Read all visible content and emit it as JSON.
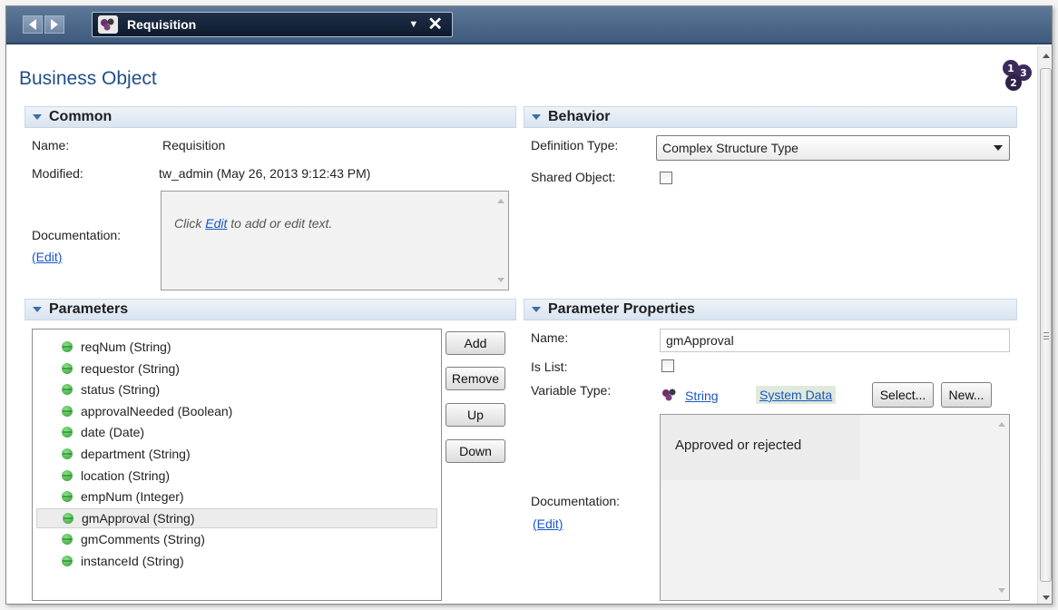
{
  "tab": {
    "title": "Requisition"
  },
  "page": {
    "title": "Business Object"
  },
  "common": {
    "header": "Common",
    "name_label": "Name:",
    "name_value": "Requisition",
    "modified_label": "Modified:",
    "modified_value": "tw_admin (May 26, 2013 9:12:43 PM)",
    "documentation_label": "Documentation:",
    "edit_link": "(Edit)",
    "doc_placeholder_prefix": "Click ",
    "doc_placeholder_link": "Edit",
    "doc_placeholder_suffix": " to add or edit text."
  },
  "behavior": {
    "header": "Behavior",
    "definition_type_label": "Definition Type:",
    "definition_type_value": "Complex Structure Type",
    "shared_object_label": "Shared Object:",
    "shared_object_checked": false
  },
  "parameters": {
    "header": "Parameters",
    "items": [
      {
        "label": "reqNum (String)"
      },
      {
        "label": "requestor (String)"
      },
      {
        "label": "status (String)"
      },
      {
        "label": "approvalNeeded (Boolean)"
      },
      {
        "label": "date (Date)"
      },
      {
        "label": "department (String)"
      },
      {
        "label": "location (String)"
      },
      {
        "label": "empNum (Integer)"
      },
      {
        "label": "gmApproval (String)"
      },
      {
        "label": "gmComments (String)"
      },
      {
        "label": "instanceId (String)"
      }
    ],
    "selected_index": 8,
    "buttons": {
      "add": "Add",
      "remove": "Remove",
      "up": "Up",
      "down": "Down"
    }
  },
  "parameter_properties": {
    "header": "Parameter Properties",
    "name_label": "Name:",
    "name_value": "gmApproval",
    "is_list_label": "Is List:",
    "is_list_checked": false,
    "variable_type_label": "Variable Type:",
    "variable_type_value": "String",
    "variable_type_source": "System Data",
    "select_button": "Select...",
    "new_button": "New...",
    "documentation_label": "Documentation:",
    "edit_link": "(Edit)",
    "documentation_text": "Approved or rejected"
  },
  "colors": {
    "title_blue": "#1f4f86",
    "tabbar": "#3e5a7c",
    "link": "#1a55c7",
    "status_green": "#2e9a2e",
    "system_data_bg": "#dfeadc"
  },
  "icons": [
    "back-arrow-icon",
    "forward-arrow-icon",
    "business-object-icon",
    "dropdown-caret-icon",
    "close-icon",
    "numbered-steps-icon",
    "collapse-caret-icon",
    "parameter-dot-icon"
  ]
}
